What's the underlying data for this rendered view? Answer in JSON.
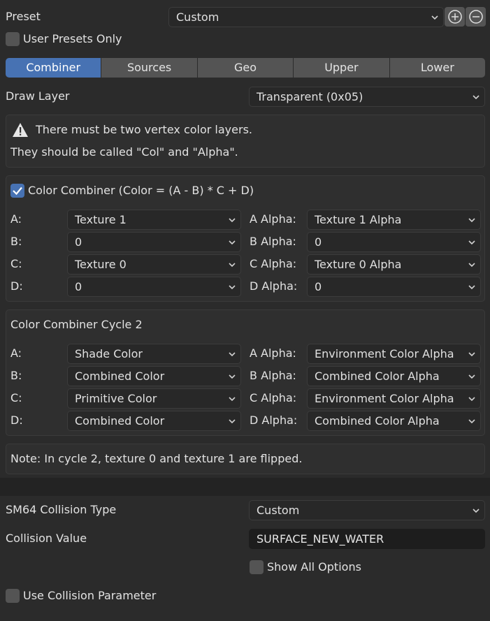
{
  "preset": {
    "label": "Preset",
    "value": "Custom",
    "user_presets_only_label": "User Presets Only"
  },
  "tabs": [
    "Combiner",
    "Sources",
    "Geo",
    "Upper",
    "Lower"
  ],
  "draw_layer": {
    "label": "Draw Layer",
    "value": "Transparent (0x05)"
  },
  "warning": {
    "line1": "There must be two vertex color layers.",
    "line2": "They should be called \"Col\" and \"Alpha\"."
  },
  "cycle1": {
    "title": "Color Combiner (Color = (A - B) * C + D)",
    "checked": true,
    "rows": [
      {
        "label": "A:",
        "value": "Texture 1",
        "alpha_label": "A Alpha:",
        "alpha_value": "Texture 1 Alpha"
      },
      {
        "label": "B:",
        "value": "0",
        "alpha_label": "B Alpha:",
        "alpha_value": "0"
      },
      {
        "label": "C:",
        "value": "Texture 0",
        "alpha_label": "C Alpha:",
        "alpha_value": "Texture 0 Alpha"
      },
      {
        "label": "D:",
        "value": "0",
        "alpha_label": "D Alpha:",
        "alpha_value": "0"
      }
    ]
  },
  "cycle2": {
    "title": "Color Combiner Cycle 2",
    "rows": [
      {
        "label": "A:",
        "value": "Shade Color",
        "alpha_label": "A Alpha:",
        "alpha_value": "Environment Color Alpha"
      },
      {
        "label": "B:",
        "value": "Combined Color",
        "alpha_label": "B Alpha:",
        "alpha_value": "Combined Color Alpha"
      },
      {
        "label": "C:",
        "value": "Primitive Color",
        "alpha_label": "C Alpha:",
        "alpha_value": "Environment Color Alpha"
      },
      {
        "label": "D:",
        "value": "Combined Color",
        "alpha_label": "D Alpha:",
        "alpha_value": "Combined Color Alpha"
      }
    ]
  },
  "note": "Note: In cycle 2, texture 0 and texture 1 are flipped.",
  "collision": {
    "type_label": "SM64 Collision Type",
    "type_value": "Custom",
    "value_label": "Collision Value",
    "value_value": "SURFACE_NEW_WATER",
    "show_all_label": "Show All Options",
    "use_param_label": "Use Collision Parameter"
  },
  "colors": {
    "accent": "#4772b3",
    "background": "#2b2b2b",
    "panel": "#2f2f2f",
    "button": "#545454"
  },
  "icons": [
    "chevron-down-icon",
    "add-preset-icon",
    "remove-preset-icon",
    "warning-icon",
    "checkmark-icon"
  ]
}
